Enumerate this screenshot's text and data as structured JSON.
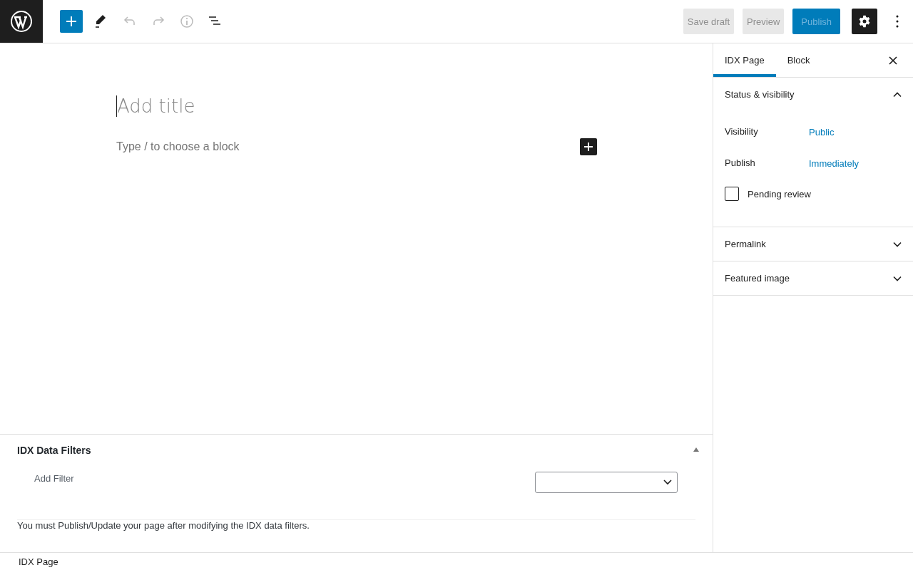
{
  "toolbar": {
    "tools": [
      {
        "kind": "add",
        "disabled": false
      },
      {
        "kind": "edit",
        "disabled": false
      },
      {
        "kind": "undo",
        "disabled": true
      },
      {
        "kind": "redo",
        "disabled": true
      },
      {
        "kind": "info",
        "disabled": true
      },
      {
        "kind": "outline",
        "disabled": false
      }
    ],
    "actions": [
      {
        "kind": "secondary",
        "label": "Save draft",
        "disabled": true
      },
      {
        "kind": "secondary",
        "label": "Preview",
        "disabled": true
      },
      {
        "kind": "primary",
        "label": "Publish",
        "disabled": true
      }
    ],
    "settings": {
      "pressed": true
    }
  },
  "editor": {
    "title_placeholder": "Add title",
    "block_placeholder": "Type / to choose a block"
  },
  "metabox": {
    "title": "IDX Data Filters",
    "expanded": true,
    "filter_label": "Add Filter",
    "note": "You must Publish/Update your page after modifying the IDX data filters."
  },
  "sidebar": {
    "tabs": [
      {
        "label": "IDX Page",
        "selected": true
      },
      {
        "label": "Block",
        "selected": false
      }
    ],
    "panels": [
      {
        "title": "Status & visibility",
        "expanded": true,
        "rows": [
          {
            "kind": "link",
            "label": "Visibility",
            "value": "Public"
          },
          {
            "kind": "link",
            "label": "Publish",
            "value": "Immediately"
          },
          {
            "kind": "checkbox",
            "label": "Pending review",
            "checked": false
          }
        ]
      },
      {
        "title": "Permalink",
        "expanded": false
      },
      {
        "title": "Featured image",
        "expanded": false
      }
    ]
  },
  "footer": {
    "breadcrumb": "IDX Page"
  }
}
